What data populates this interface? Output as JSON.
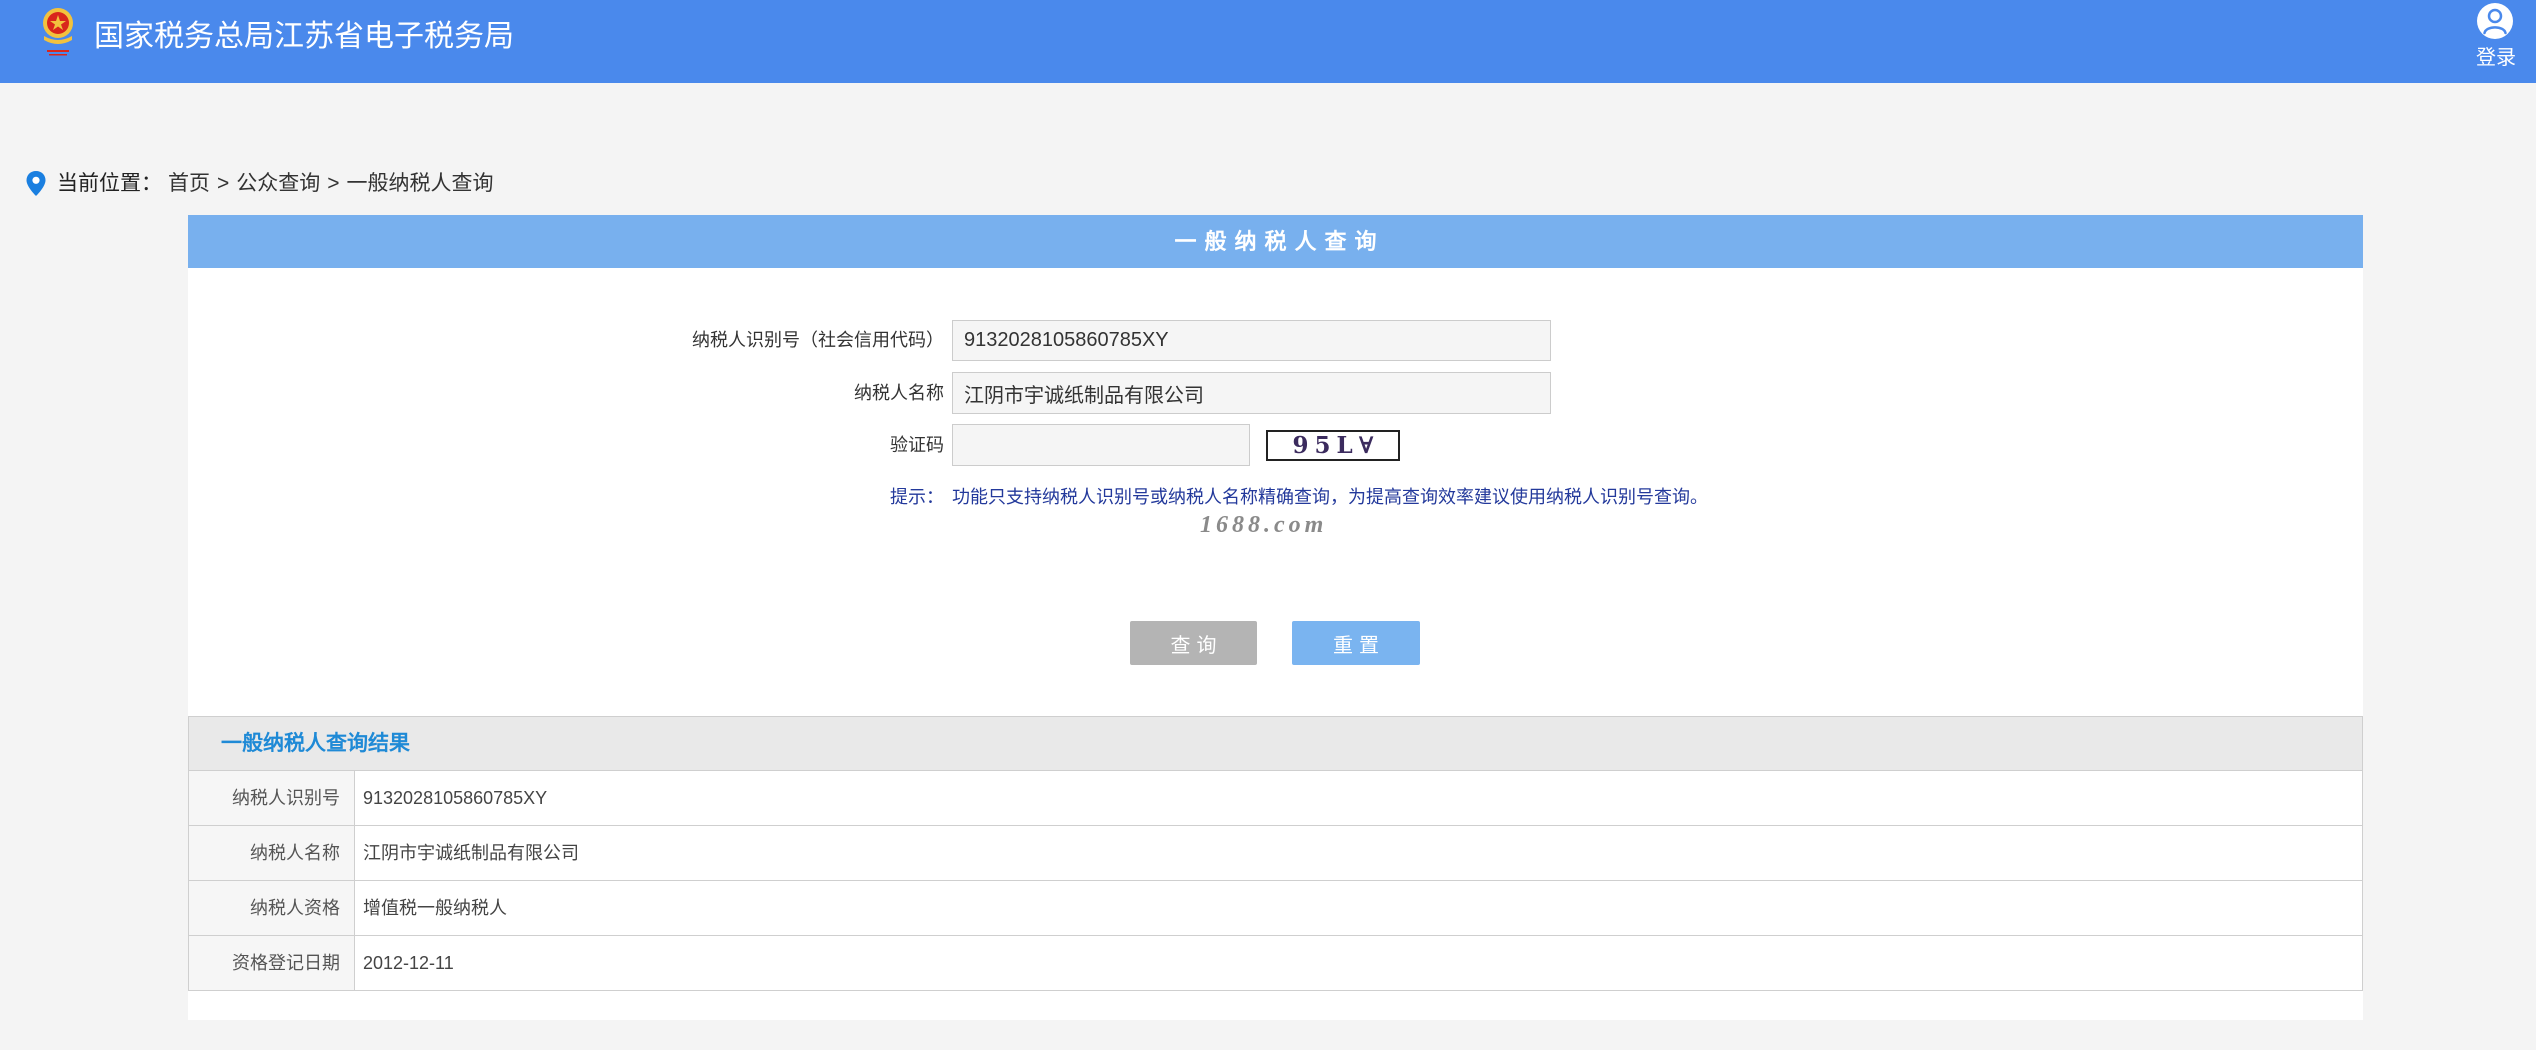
{
  "header": {
    "title": "国家税务总局江苏省电子税务局",
    "login_label": "登录"
  },
  "breadcrumb": {
    "prefix": "当前位置：",
    "items": [
      "首页",
      "公众查询",
      "一般纳税人查询"
    ],
    "separator": ">"
  },
  "panel": {
    "title": "一般纳税人查询"
  },
  "form": {
    "id_label": "纳税人识别号（社会信用代码）",
    "id_value": "9132028105860785XY",
    "name_label": "纳税人名称",
    "name_value": "江阴市宇诚纸制品有限公司",
    "captcha_label": "验证码",
    "captcha_image_text": "95L∀",
    "hint_label": "提示：",
    "hint_text": "功能只支持纳税人识别号或纳税人名称精确查询，为提高查询效率建议使用纳税人识别号查询。",
    "query_button": "查询",
    "reset_button": "重置"
  },
  "watermark": "1688.com",
  "results": {
    "title": "一般纳税人查询结果",
    "rows": [
      {
        "label": "纳税人识别号",
        "value": "9132028105860785XY"
      },
      {
        "label": "纳税人名称",
        "value": "江阴市宇诚纸制品有限公司"
      },
      {
        "label": "纳税人资格",
        "value": "增值税一般纳税人"
      },
      {
        "label": "资格登记日期",
        "value": "2012-12-11"
      }
    ]
  },
  "icons": {
    "emblem": "tax-emblem-icon",
    "user": "user-icon",
    "location": "location-pin-icon"
  },
  "colors": {
    "header_bg": "#4a89ec",
    "title_bar_bg": "#78b0ee",
    "page_bg": "#f4f4f4",
    "hint_text": "#23399b",
    "result_title": "#1f8ad6",
    "query_button_bg": "#b4b4b4",
    "reset_button_bg": "#7ab4f0"
  }
}
